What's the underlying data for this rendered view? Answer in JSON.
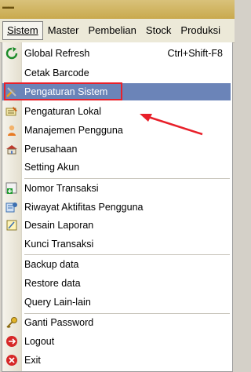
{
  "menubar": {
    "items": [
      {
        "label": "Sistem",
        "accel_underline": "S"
      },
      {
        "label": "Master",
        "accel_underline": "M"
      },
      {
        "label": "Pembelian",
        "accel_underline": ""
      },
      {
        "label": "Stock",
        "accel_underline": "S"
      },
      {
        "label": "Produksi",
        "accel_underline": "P"
      }
    ]
  },
  "menu": {
    "items": [
      {
        "label": "Global Refresh",
        "shortcut": "Ctrl+Shift-F8",
        "icon": "refresh-icon"
      },
      {
        "label": "Cetak Barcode",
        "icon": ""
      },
      {
        "label": "Pengaturan Sistem",
        "icon": "tools-icon",
        "highlighted": true
      },
      {
        "label": "Pengaturan Lokal",
        "icon": "settings-list-icon"
      },
      {
        "label": "Manajemen Pengguna",
        "icon": "user-icon"
      },
      {
        "label": "Perusahaan",
        "icon": "building-icon"
      },
      {
        "label": "Setting Akun",
        "icon": ""
      },
      {
        "label": "Nomor Transaksi",
        "icon": "add-number-icon"
      },
      {
        "label": "Riwayat Aktifitas Pengguna",
        "icon": "history-icon"
      },
      {
        "label": "Desain Laporan",
        "icon": "report-design-icon"
      },
      {
        "label": "Kunci Transaksi",
        "icon": ""
      },
      {
        "label": "Backup data",
        "icon": ""
      },
      {
        "label": "Restore data",
        "icon": ""
      },
      {
        "label": "Query Lain-lain",
        "icon": ""
      },
      {
        "label": "Ganti Password",
        "icon": "key-icon"
      },
      {
        "label": "Logout",
        "icon": "logout-icon"
      },
      {
        "label": "Exit",
        "icon": "exit-icon"
      }
    ]
  },
  "colors": {
    "highlight": "#6b84b8",
    "annotation": "#e8202a"
  }
}
